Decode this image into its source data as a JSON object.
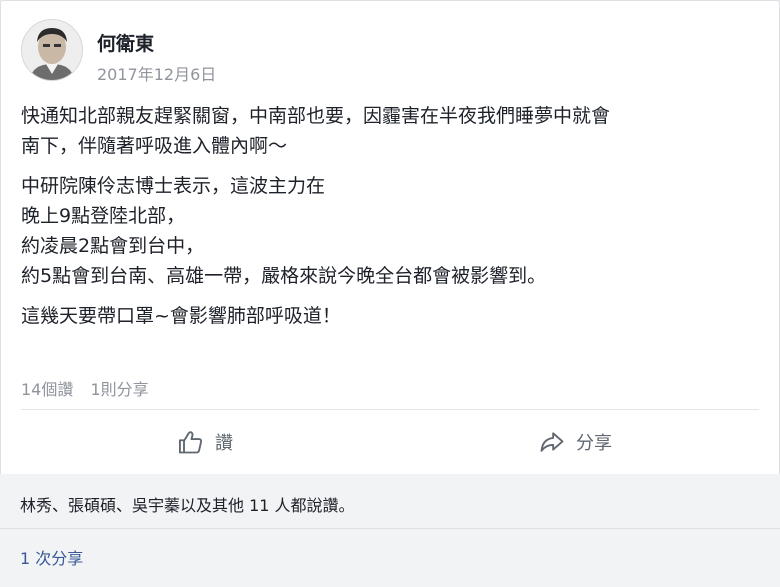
{
  "post": {
    "author": "何衛東",
    "date": "2017年12月6日",
    "paragraphs": [
      [
        "快通知北部親友趕緊關窗，中南部也要，因霾害在半夜我們睡夢中就會",
        "南下，伴隨著呼吸進入體內啊～"
      ],
      [
        "中研院陳伶志博士表示，這波主力在",
        "晚上9點登陸北部，",
        "約凌晨2點會到台中，",
        "約5點會到台南、高雄一帶，嚴格來說今晚全台都會被影響到。"
      ],
      [
        "這幾天要帶口罩~會影響肺部呼吸道！"
      ]
    ]
  },
  "stats": {
    "likes": "14個讚",
    "shares": "1則分享"
  },
  "actions": {
    "like_label": "讚",
    "share_label": "分享"
  },
  "likers_text": "林秀、張碩碩、吳宇蓁以及其他 11 人都說讚。",
  "shares_link": "1 次分享",
  "colors": {
    "link": "#385898",
    "muted": "#90949c",
    "text": "#1d2129"
  }
}
